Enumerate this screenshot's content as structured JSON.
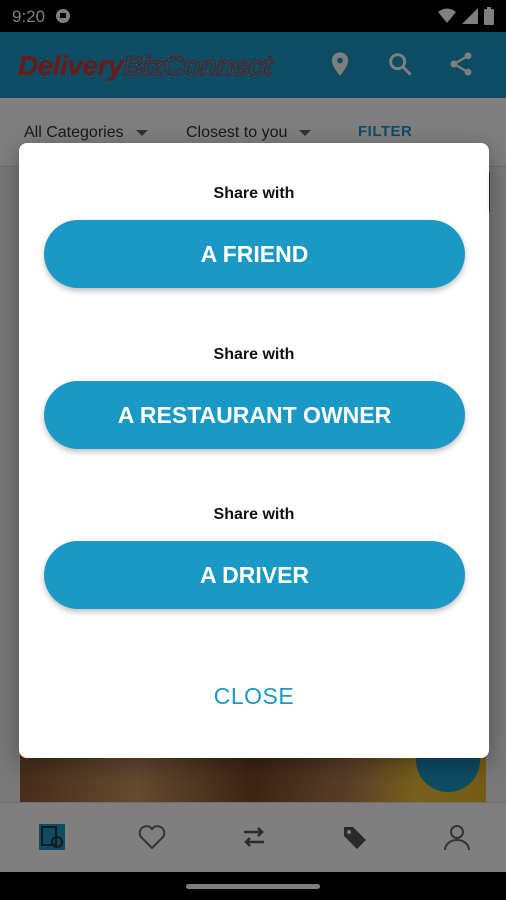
{
  "status_bar": {
    "time": "9:20"
  },
  "app_bar": {
    "logo_part1": "Delivery",
    "logo_part2": "BizConnect"
  },
  "filter_bar": {
    "category": "All Categories",
    "sort": "Closest to you",
    "filter_label": "FILTER"
  },
  "dialog": {
    "sections": [
      {
        "caption": "Share with",
        "button": "A FRIEND"
      },
      {
        "caption": "Share with",
        "button": "A RESTAURANT OWNER"
      },
      {
        "caption": "Share with",
        "button": "A DRIVER"
      }
    ],
    "close_label": "CLOSE"
  },
  "colors": {
    "accent": "#1b99c6",
    "brand_red": "#d9302a",
    "scrim": "rgba(0,0,0,0.5)"
  },
  "icons": [
    "location-pin-icon",
    "search-icon",
    "share-icon",
    "menu-card-icon",
    "heart-icon",
    "swap-icon",
    "tags-icon",
    "profile-icon"
  ]
}
